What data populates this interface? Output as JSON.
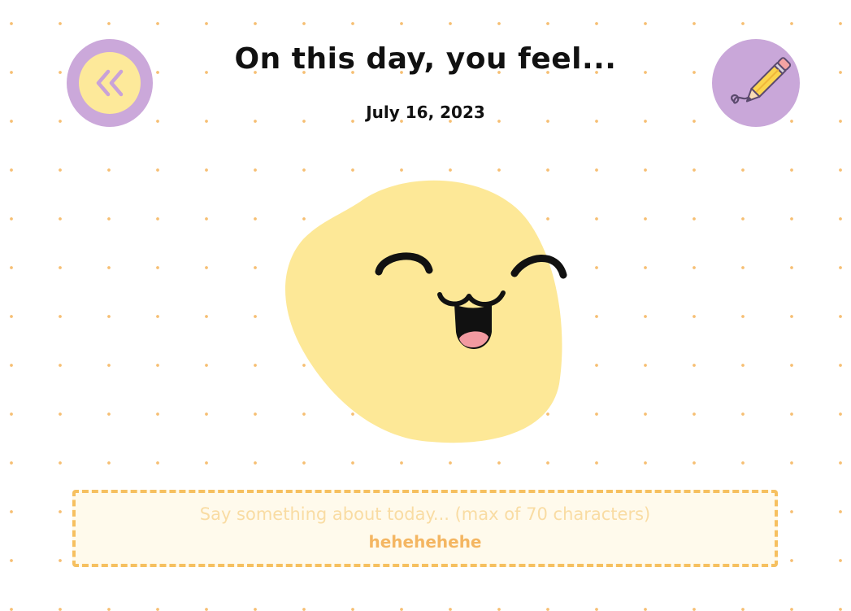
{
  "header": {
    "title": "On this day, you feel...",
    "date": "July 16, 2023"
  },
  "nav": {
    "back_icon": "double-chevron-left-icon",
    "edit_icon": "pencil-icon"
  },
  "mood": {
    "face_icon": "happy-face-icon",
    "color": "#fde897"
  },
  "note": {
    "placeholder": "Say something about today... (max of 70 characters)",
    "value": "hehehehehe"
  },
  "colors": {
    "accent_purple": "#cba8da",
    "accent_yellow": "#fde99a",
    "dot": "#f6bf74",
    "note_border": "#f6c060",
    "note_text": "#f4b662"
  }
}
